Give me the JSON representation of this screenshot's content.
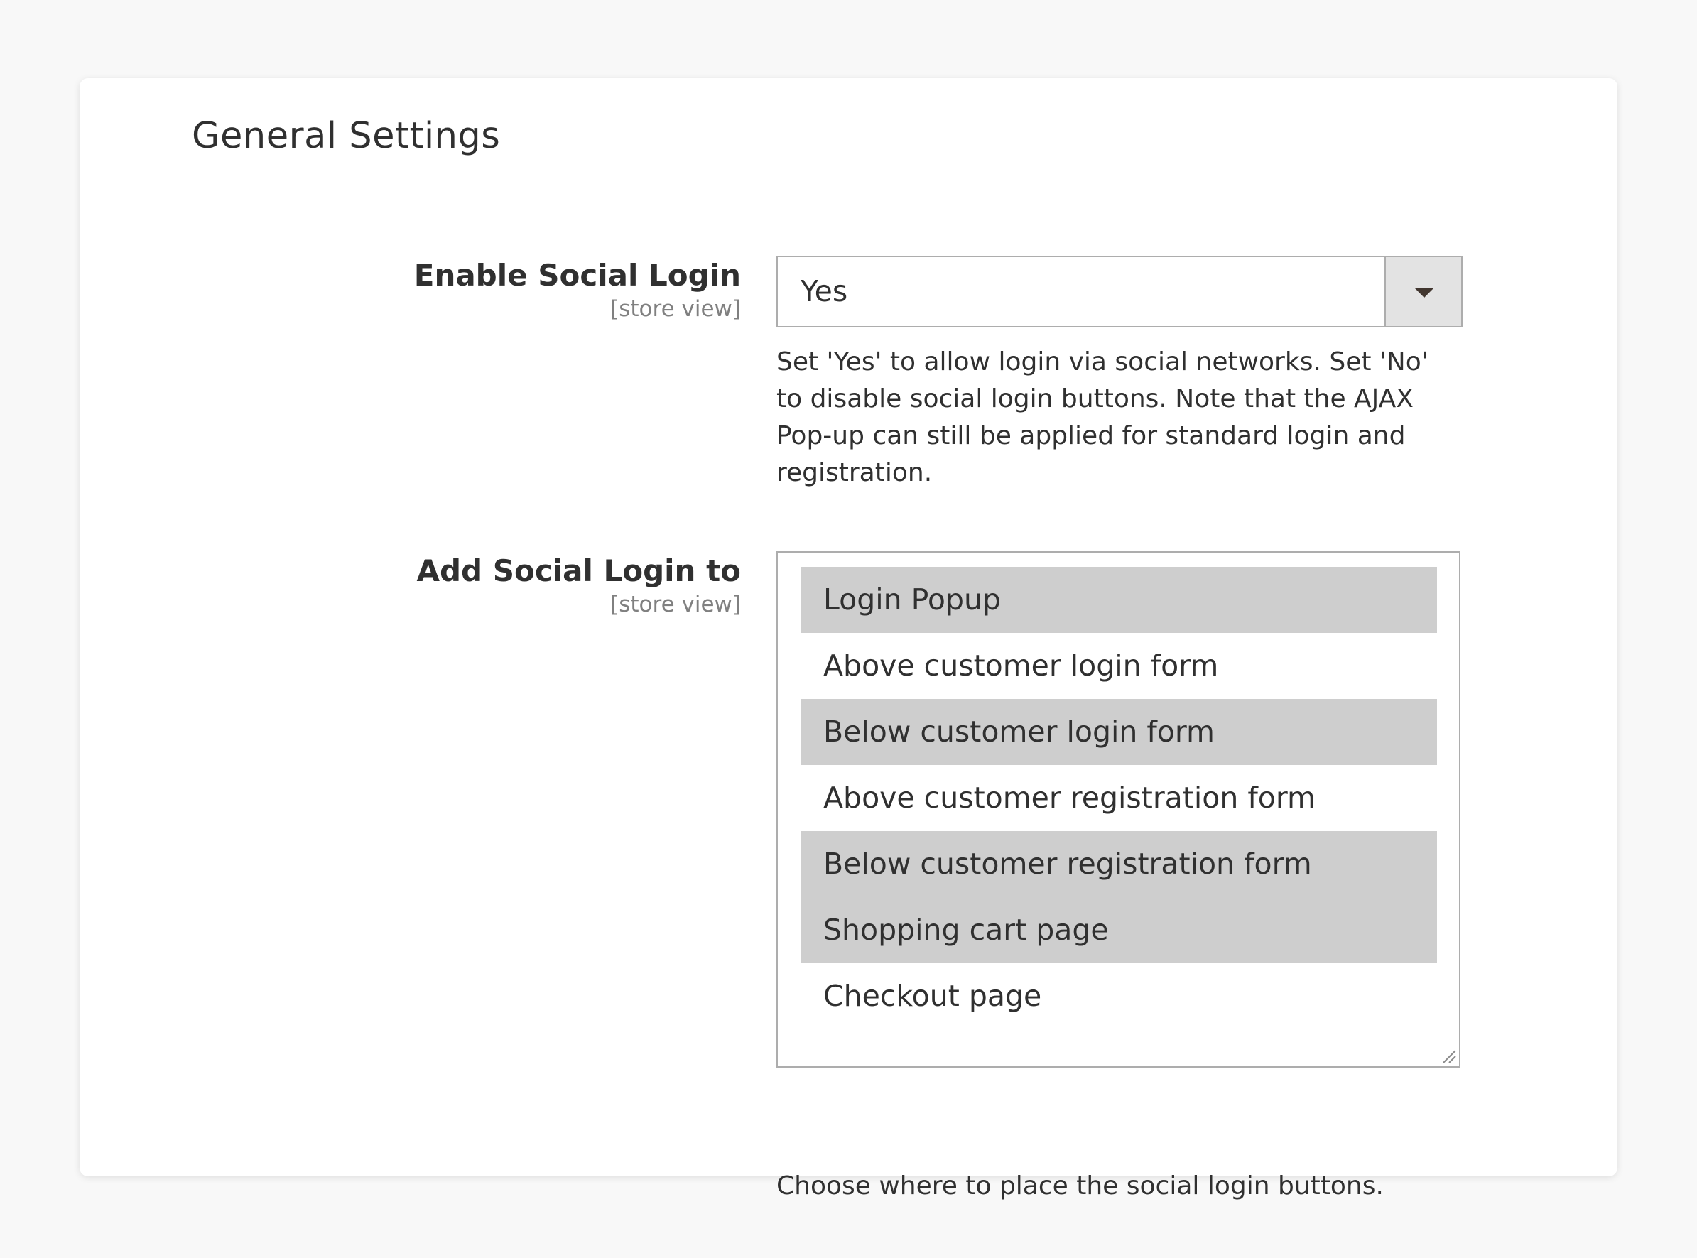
{
  "section": {
    "title": "General Settings"
  },
  "fields": {
    "enable_social_login": {
      "label": "Enable Social Login",
      "scope": "[store view]",
      "value": "Yes",
      "note": "Set 'Yes' to allow login via social networks. Set 'No' to disable social login buttons. Note that the AJAX Pop-up can still be applied for standard login and registration."
    },
    "add_social_login_to": {
      "label": "Add Social Login to",
      "scope": "[store view]",
      "options": [
        {
          "label": "Login Popup",
          "selected": true
        },
        {
          "label": "Above customer login form",
          "selected": false
        },
        {
          "label": "Below customer login form",
          "selected": true
        },
        {
          "label": "Above customer registration form",
          "selected": false
        },
        {
          "label": "Below customer registration form",
          "selected": true
        },
        {
          "label": "Shopping cart page",
          "selected": true
        },
        {
          "label": "Checkout page",
          "selected": false
        }
      ],
      "note": "Choose where to place the social login buttons."
    }
  },
  "icons": {
    "dropdown": "chevron-down-icon",
    "resize": "resize-grip-icon"
  },
  "colors": {
    "selected_option_bg": "#cecece",
    "select_button_bg": "#e3e3e3",
    "border": "#adadad",
    "text": "#303030",
    "scope_text": "#808080"
  }
}
